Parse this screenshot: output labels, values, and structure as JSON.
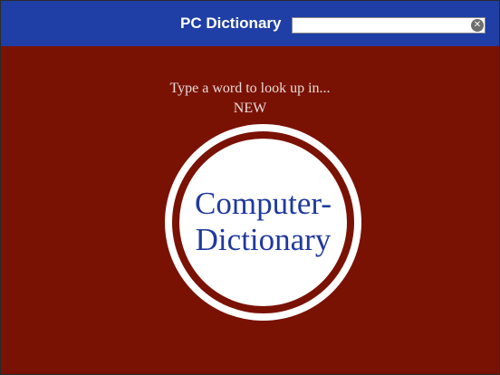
{
  "header": {
    "title": "PC Dictionary",
    "search": {
      "value": "",
      "placeholder": ""
    },
    "clear_icon": "clear-circle-x-icon"
  },
  "prompt": {
    "line1": "Type a word to look up in...",
    "line2": "NEW"
  },
  "logo": {
    "line1": "Computer-",
    "line2": "Dictionary"
  },
  "colors": {
    "header_bg": "#1f3fa6",
    "page_bg": "#7a1203",
    "logo_text": "#1f3a9e",
    "prompt_text": "#e6dcd8"
  }
}
